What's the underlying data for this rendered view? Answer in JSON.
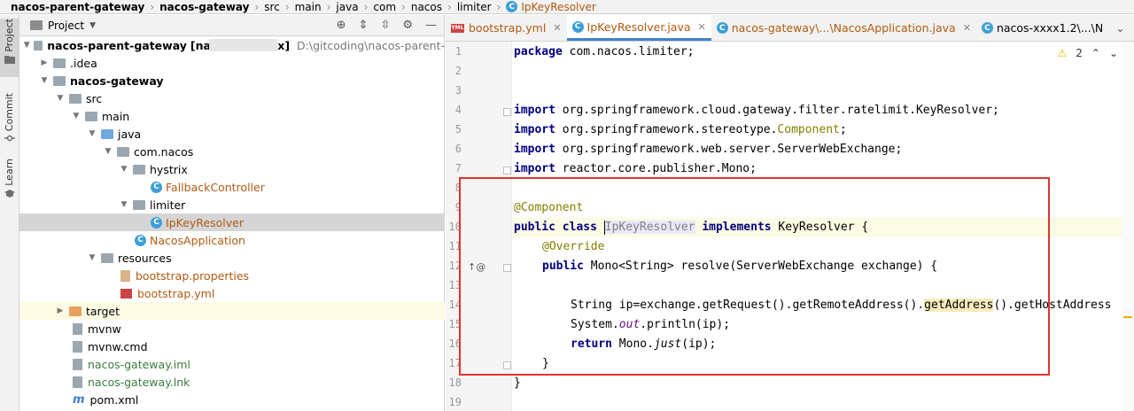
{
  "breadcrumb": [
    "nacos-parent-gateway",
    "nacos-gateway",
    "src",
    "main",
    "java",
    "com",
    "nacos",
    "limiter",
    "IpKeyResolver"
  ],
  "toolstrip": {
    "project": "Project",
    "commit": "Commit",
    "learn": "Learn"
  },
  "project_panel": {
    "title": "Project",
    "tree": [
      {
        "label": "nacos-parent-gateway",
        "suffix": "[na",
        "suffix2": "x]",
        "path": "D:\\gitcoding\\nacos-parent-"
      },
      {
        "label": ".idea"
      },
      {
        "label": "nacos-gateway"
      },
      {
        "label": "src"
      },
      {
        "label": "main"
      },
      {
        "label": "java"
      },
      {
        "label": "com.nacos"
      },
      {
        "label": "hystrix"
      },
      {
        "label": "FallbackController"
      },
      {
        "label": "limiter"
      },
      {
        "label": "IpKeyResolver"
      },
      {
        "label": "NacosApplication"
      },
      {
        "label": "resources"
      },
      {
        "label": "bootstrap.properties"
      },
      {
        "label": "bootstrap.yml"
      },
      {
        "label": "target"
      },
      {
        "label": "mvnw"
      },
      {
        "label": "mvnw.cmd"
      },
      {
        "label": "nacos-gateway.iml"
      },
      {
        "label": "nacos-gateway.lnk"
      },
      {
        "label": "pom.xml"
      }
    ]
  },
  "tabs": [
    {
      "label": "bootstrap.yml"
    },
    {
      "label": "IpKeyResolver.java"
    },
    {
      "label": "nacos-gateway\\...\\NacosApplication.java"
    },
    {
      "label": "nacos-xxxx1.2\\...\\N"
    }
  ],
  "inspections": {
    "warnings": "2"
  },
  "editor": {
    "line_numbers": [
      "1",
      "2",
      "3",
      "4",
      "5",
      "6",
      "7",
      "8",
      "9",
      "10",
      "11",
      "12",
      "13",
      "14",
      "15",
      "16",
      "17",
      "18",
      "19"
    ],
    "code": {
      "l1_kw": "package",
      "l1": " com.nacos.limiter;",
      "l4_kw": "import",
      "l4": " org.springframework.cloud.gateway.filter.ratelimit.KeyResolver;",
      "l5_kw": "import",
      "l5a": " org.springframework.stereotype.",
      "l5b": "Component",
      "l5c": ";",
      "l6_kw": "import",
      "l6": " org.springframework.web.server.ServerWebExchange;",
      "l7_kw": "import",
      "l7": " reactor.core.publisher.Mono;",
      "l9": "@Component",
      "l10_kw1": "public class ",
      "l10_name": "IpKeyResolver",
      "l10_kw2": " implements",
      "l10_rest": " KeyResolver {",
      "l11": "@Override",
      "l12_kw": "public",
      "l12": " Mono<String> resolve(ServerWebExchange exchange) {",
      "l14a": "String ip=exchange.getRequest().getRemoteAddress().",
      "l14b": "getAddress",
      "l14c": "().getHostAddress",
      "l15a": "System.",
      "l15b": "out",
      "l15c": ".println(ip);",
      "l16_kw": "return",
      "l16a": " Mono.",
      "l16b": "just",
      "l16c": "(ip);",
      "l17": "}",
      "l18": "}"
    }
  }
}
